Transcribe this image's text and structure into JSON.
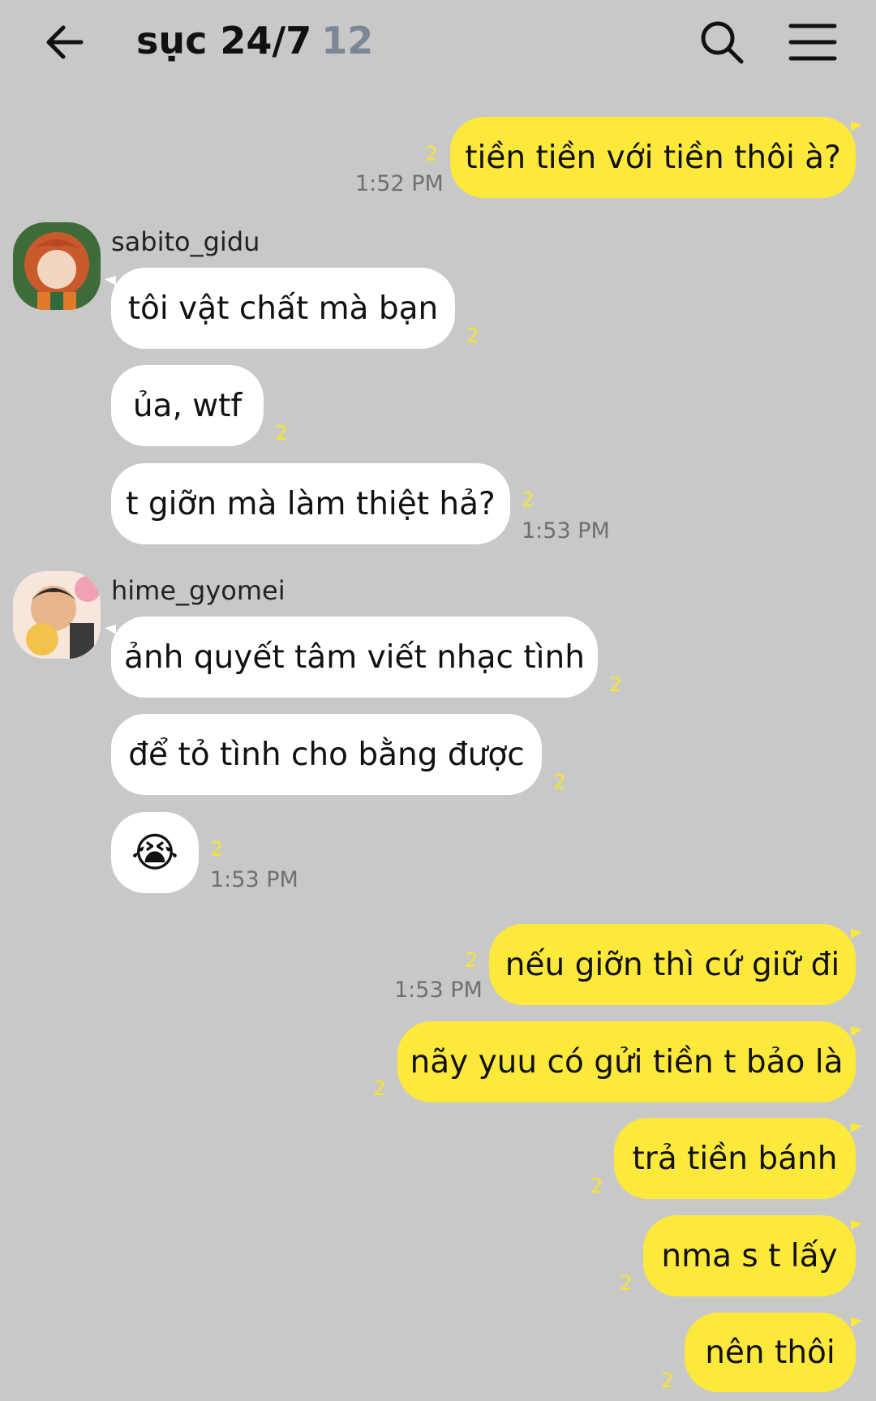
{
  "header": {
    "title": "sục 24/7",
    "member_count": "12",
    "back_icon": "arrow-left-icon",
    "search_icon": "search-icon",
    "menu_icon": "menu-icon"
  },
  "messages": [
    {
      "author": "me",
      "text": "tiền tiền với tiền thôi à?",
      "unread": "2",
      "time": "1:52 PM"
    },
    {
      "author": "sabito_gidu",
      "text": "tôi vật chất mà bạn",
      "unread": "2"
    },
    {
      "author": "sabito_gidu",
      "text": "ủa, wtf",
      "unread": "2"
    },
    {
      "author": "sabito_gidu",
      "text": "t giỡn mà làm thiệt hả?",
      "unread": "2",
      "time": "1:53 PM"
    },
    {
      "author": "hime_gyomei",
      "text": "ảnh quyết tâm viết nhạc tình",
      "unread": "2"
    },
    {
      "author": "hime_gyomei",
      "text": "để tỏ tình cho bằng được",
      "unread": "2"
    },
    {
      "author": "hime_gyomei",
      "text": "😭",
      "unread": "2",
      "time": "1:53 PM"
    },
    {
      "author": "me",
      "text": "nếu giỡn thì cứ giữ đi",
      "unread": "2",
      "time": "1:53 PM"
    },
    {
      "author": "me",
      "text": "nãy yuu có gửi tiền t bảo là",
      "unread": "2"
    },
    {
      "author": "me",
      "text": "trả tiền bánh",
      "unread": "2"
    },
    {
      "author": "me",
      "text": "nma s t lấy",
      "unread": "2"
    },
    {
      "author": "me",
      "text": "nên thôi",
      "unread": "2"
    }
  ],
  "senders": [
    "sabito_gidu",
    "hime_gyomei"
  ],
  "colors": {
    "background": "#c8c8c8",
    "my_bubble": "#fde93c",
    "their_bubble": "#ffffff",
    "unread": "#f4e52f"
  }
}
